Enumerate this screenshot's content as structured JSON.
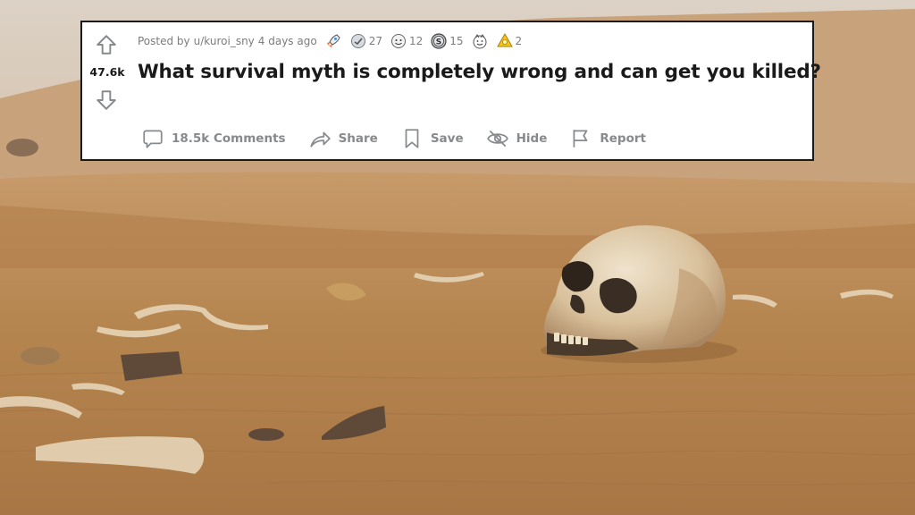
{
  "post": {
    "score": "47.6k",
    "meta_prefix": "Posted by",
    "author": "u/kuroi_sny",
    "age": "4 days ago",
    "title": "What survival myth is completely wrong and can get you killed?",
    "awards": [
      {
        "icon": "rocket-award-icon",
        "count": ""
      },
      {
        "icon": "helpful-award-icon",
        "count": "27"
      },
      {
        "icon": "wholesome-award-icon",
        "count": "12"
      },
      {
        "icon": "silver-award-icon",
        "count": "15"
      },
      {
        "icon": "wholesome-seal-award-icon",
        "count": ""
      },
      {
        "icon": "gold-award-icon",
        "count": "2"
      }
    ],
    "actions": {
      "comments": "18.5k Comments",
      "share": "Share",
      "save": "Save",
      "hide": "Hide",
      "report": "Report"
    }
  },
  "colors": {
    "card_bg": "#ffffff",
    "text_primary": "#1a1a1b",
    "text_meta": "#7c7c7c",
    "action_text": "#878a8c",
    "sand": "#b98a57"
  }
}
